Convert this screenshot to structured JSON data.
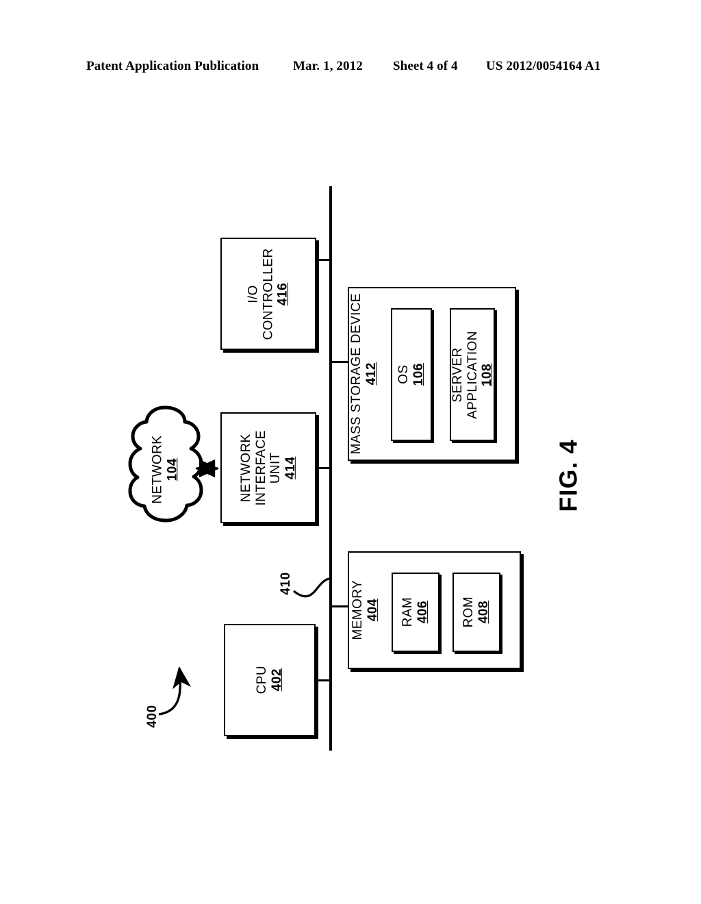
{
  "header": {
    "publication": "Patent Application Publication",
    "date": "Mar. 1, 2012",
    "sheet": "Sheet 4 of 4",
    "number": "US 2012/0054164 A1"
  },
  "figure": {
    "caption": "FIG. 4",
    "system_ref": "400",
    "bus_ref": "410"
  },
  "blocks": {
    "io_controller": {
      "label": "I/O\nCONTROLLER",
      "line1": "I/O",
      "line2": "CONTROLLER",
      "ref": "416"
    },
    "network_interface_unit": {
      "line1": "NETWORK",
      "line2": "INTERFACE",
      "line3": "UNIT",
      "ref": "414"
    },
    "cpu": {
      "line1": "CPU",
      "ref": "402"
    },
    "mass_storage_device": {
      "line1": "MASS STORAGE DEVICE",
      "ref": "412"
    },
    "os": {
      "line1": "OS",
      "ref": "106"
    },
    "server_application": {
      "line1": "SERVER",
      "line2": "APPLICATION",
      "ref": "108"
    },
    "memory": {
      "line1": "MEMORY",
      "ref": "404"
    },
    "ram": {
      "line1": "RAM",
      "ref": "406"
    },
    "rom": {
      "line1": "ROM",
      "ref": "408"
    },
    "network_cloud": {
      "line1": "NETWORK",
      "ref": "104"
    }
  },
  "colors": {
    "ink": "#000000",
    "paper": "#ffffff"
  }
}
